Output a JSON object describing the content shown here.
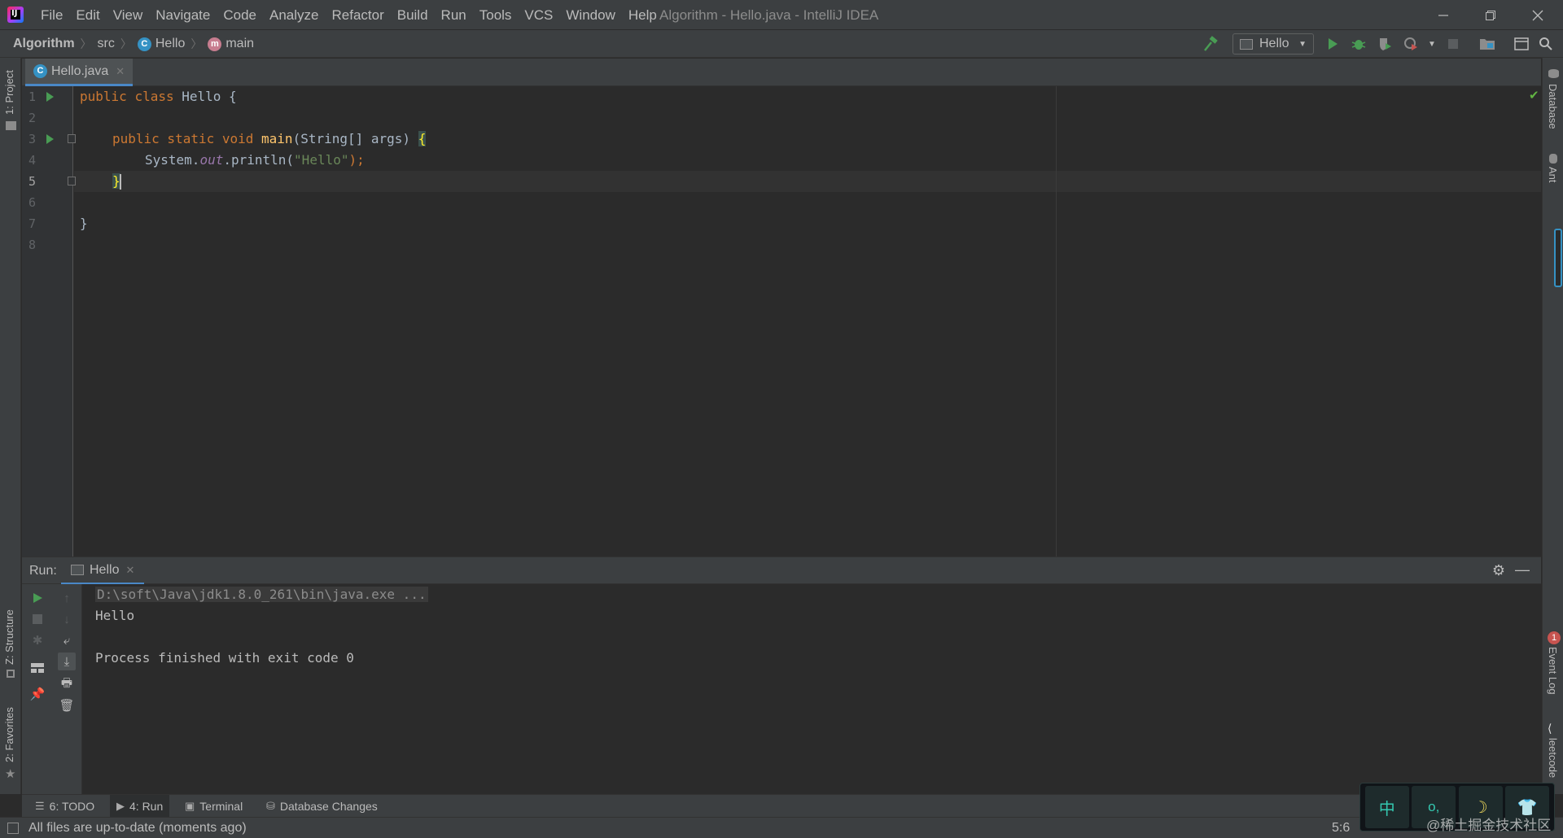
{
  "titlebar": {
    "menu": [
      "File",
      "Edit",
      "View",
      "Navigate",
      "Code",
      "Analyze",
      "Refactor",
      "Build",
      "Run",
      "Tools",
      "VCS",
      "Window",
      "Help"
    ],
    "window_title": "Algorithm - Hello.java - IntelliJ IDEA"
  },
  "navbar": {
    "crumbs": [
      "Algorithm",
      "src",
      "Hello",
      "main"
    ],
    "run_config": "Hello"
  },
  "left_tools": {
    "project": "1: Project",
    "structure": "Z: Structure",
    "favorites": "2: Favorites"
  },
  "right_tools": {
    "database": "Database",
    "ant": "Ant",
    "event_log": "Event Log",
    "leetcode": "leetcode",
    "event_count": "1"
  },
  "editor": {
    "tab_label": "Hello.java",
    "line_numbers": [
      "1",
      "2",
      "3",
      "4",
      "5",
      "6",
      "7",
      "8"
    ],
    "lines": {
      "l1_public": "public",
      "l1_class": "class",
      "l1_name": " Hello {",
      "l3_mods": "public static void",
      "l3_fn": "main",
      "l3_rest": "(String[] args) ",
      "l3_brace": "{",
      "l4_a": "System.",
      "l4_out": "out",
      "l4_b": ".println(",
      "l4_str": "\"Hello\"",
      "l4_c": ");",
      "l5_brace": "}",
      "l7_brace": "}"
    }
  },
  "run_panel": {
    "label": "Run:",
    "tab": "Hello",
    "console": {
      "cmd": "D:\\soft\\Java\\jdk1.8.0_261\\bin\\java.exe ...",
      "output": "Hello",
      "exit": "Process finished with exit code 0"
    }
  },
  "bottom_tabs": [
    "6: TODO",
    "4: Run",
    "Terminal",
    "Database Changes"
  ],
  "status": {
    "message": "All files are up-to-date (moments ago)",
    "caret": "5:6"
  },
  "ime": {
    "lang": "中",
    "punct": "о,",
    "mode": "☽",
    "skin": "👕"
  },
  "watermark": "@稀土掘金技术社区"
}
